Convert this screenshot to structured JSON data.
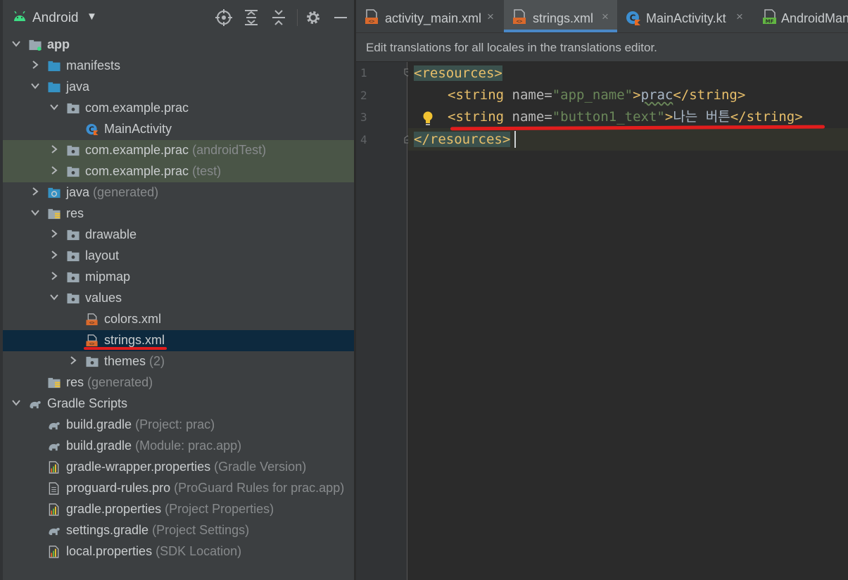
{
  "project_panel": {
    "view_name": "Android",
    "tree": [
      {
        "label": "app",
        "hint": ""
      },
      {
        "label": "manifests",
        "hint": ""
      },
      {
        "label": "java",
        "hint": ""
      },
      {
        "label": "com.example.prac",
        "hint": ""
      },
      {
        "label": "MainActivity",
        "hint": ""
      },
      {
        "label": "com.example.prac",
        "hint": "(androidTest)"
      },
      {
        "label": "com.example.prac",
        "hint": "(test)"
      },
      {
        "label": "java",
        "hint": "(generated)"
      },
      {
        "label": "res",
        "hint": ""
      },
      {
        "label": "drawable",
        "hint": ""
      },
      {
        "label": "layout",
        "hint": ""
      },
      {
        "label": "mipmap",
        "hint": ""
      },
      {
        "label": "values",
        "hint": ""
      },
      {
        "label": "colors.xml",
        "hint": ""
      },
      {
        "label": "strings.xml",
        "hint": ""
      },
      {
        "label": "themes",
        "hint": "(2)"
      },
      {
        "label": "res",
        "hint": "(generated)"
      },
      {
        "label": "Gradle Scripts",
        "hint": ""
      },
      {
        "label": "build.gradle",
        "hint": "(Project: prac)"
      },
      {
        "label": "build.gradle",
        "hint": "(Module: prac.app)"
      },
      {
        "label": "gradle-wrapper.properties",
        "hint": "(Gradle Version)"
      },
      {
        "label": "proguard-rules.pro",
        "hint": "(ProGuard Rules for prac.app)"
      },
      {
        "label": "gradle.properties",
        "hint": "(Project Properties)"
      },
      {
        "label": "settings.gradle",
        "hint": "(Project Settings)"
      },
      {
        "label": "local.properties",
        "hint": "(SDK Location)"
      }
    ]
  },
  "editor": {
    "tabs": [
      {
        "label": "activity_main.xml",
        "close": "×"
      },
      {
        "label": "strings.xml",
        "close": "×"
      },
      {
        "label": "MainActivity.kt",
        "close": "×"
      },
      {
        "label": "AndroidManifest.xml",
        "close": ""
      }
    ],
    "banner": "Edit translations for all locales in the translations editor.",
    "line_numbers": [
      "1",
      "2",
      "3",
      "4"
    ],
    "code": {
      "l1_tag": "<resources>",
      "l2_open": "<string",
      "l2_attr": " name=",
      "l2_val": "\"app_name\"",
      "l2_gt": ">",
      "l2_text": "prac",
      "l2_close": "</string>",
      "l3_open": "<string",
      "l3_attr": " name=",
      "l3_val": "\"button1_text\"",
      "l3_gt": ">",
      "l3_text": "나는 버튼",
      "l3_close": "</string>",
      "l4_tag": "</resources>"
    }
  },
  "colors": {
    "annotation_red": "#e11d1d",
    "tab_accent": "#4a88c7",
    "xml_tag": "#e8bf6a",
    "xml_value": "#6a8759"
  }
}
